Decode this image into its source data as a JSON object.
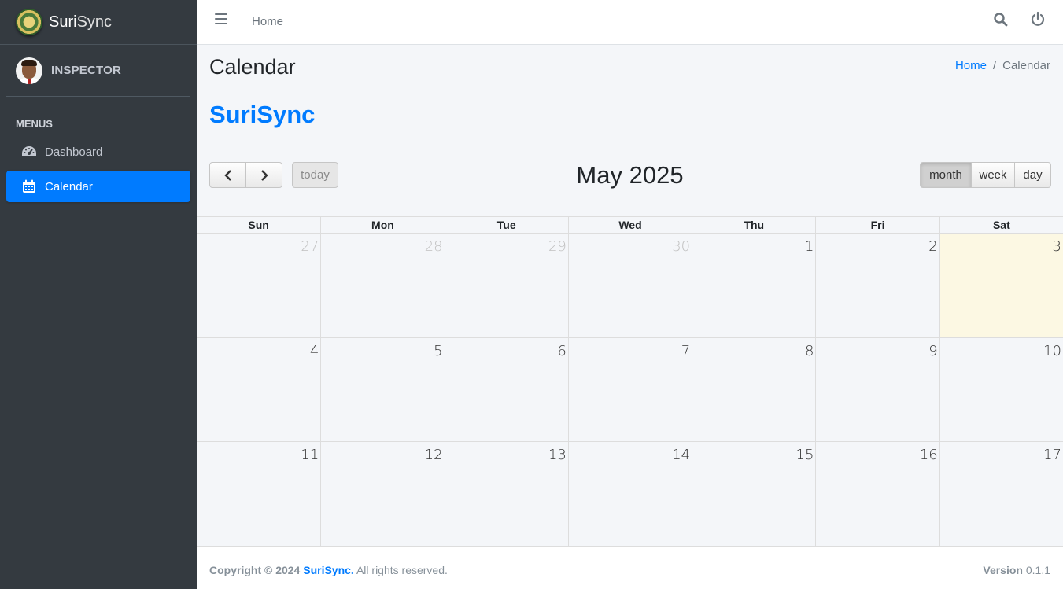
{
  "brand": {
    "name_part1": "Suri",
    "name_part2": "Sync"
  },
  "user": {
    "name": "INSPECTOR"
  },
  "sidebar": {
    "header": "MENUS",
    "items": [
      {
        "label": "Dashboard",
        "icon": "tachometer-icon",
        "active": false
      },
      {
        "label": "Calendar",
        "icon": "calendar-icon",
        "active": true
      }
    ]
  },
  "topnav": {
    "home_label": "Home"
  },
  "page": {
    "title": "Calendar",
    "breadcrumb": {
      "home": "Home",
      "separator": "/",
      "current": "Calendar"
    },
    "app_heading": "SuriSync"
  },
  "calendar": {
    "title": "May 2025",
    "today_label": "today",
    "views": {
      "month": "month",
      "week": "week",
      "day": "day",
      "active": "month"
    },
    "weekdays": [
      "Sun",
      "Mon",
      "Tue",
      "Wed",
      "Thu",
      "Fri",
      "Sat"
    ],
    "weeks": [
      [
        "27",
        "28",
        "29",
        "30",
        "1",
        "2",
        "3"
      ],
      [
        "4",
        "5",
        "6",
        "7",
        "8",
        "9",
        "10"
      ],
      [
        "11",
        "12",
        "13",
        "14",
        "15",
        "16",
        "17"
      ]
    ],
    "today": "3"
  },
  "footer": {
    "copyright": "Copyright © 2024",
    "brand": "SuriSync.",
    "rights": "All rights reserved.",
    "version_label": "Version",
    "version": "0.1.1"
  },
  "colors": {
    "primary": "#007bff",
    "sidebar_bg": "#343a40",
    "content_bg": "#f4f6f9",
    "today_bg": "#fcf8e3"
  }
}
